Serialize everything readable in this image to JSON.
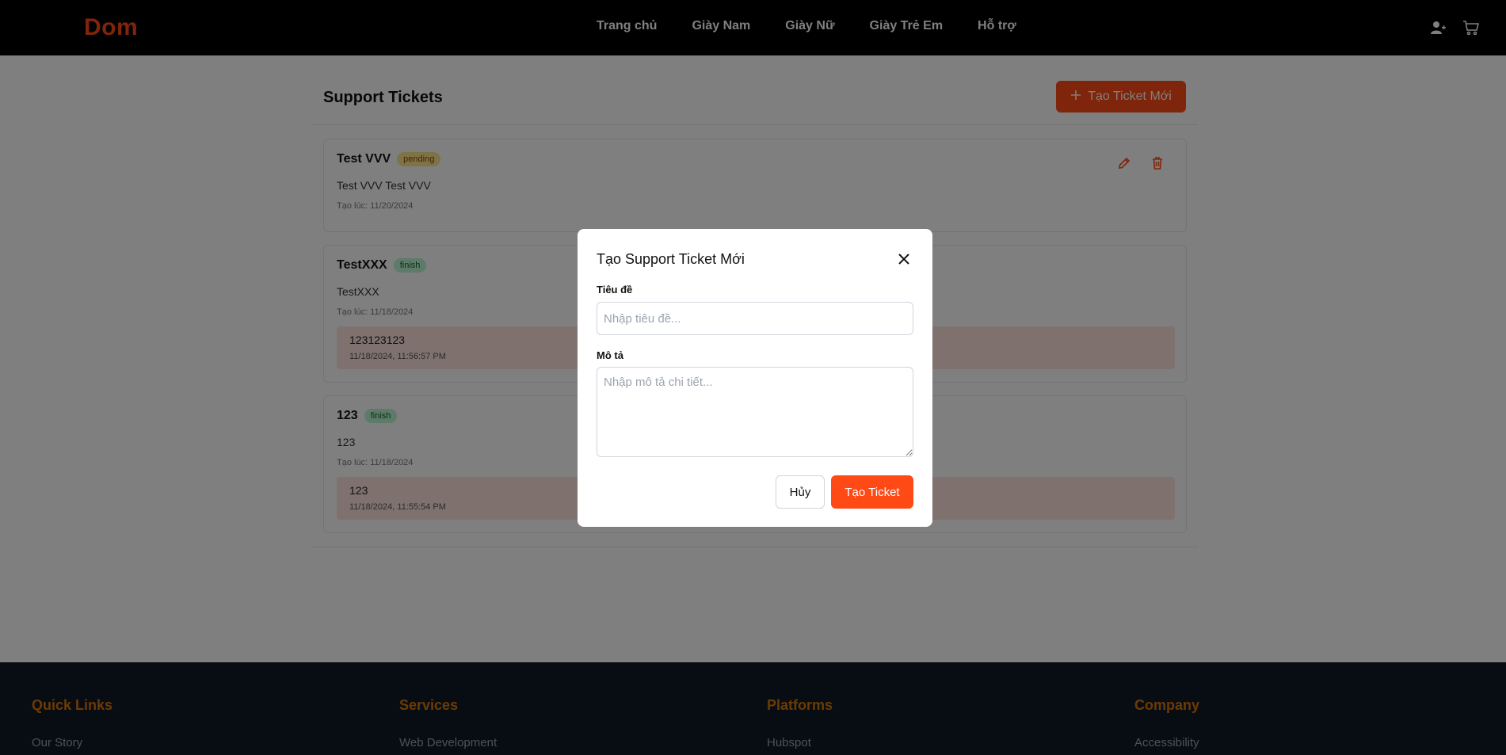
{
  "navbar": {
    "logo": "Dom",
    "links": [
      "Trang chủ",
      "Giày Nam",
      "Giày Nữ",
      "Giày Trẻ Em",
      "Hỗ trợ"
    ],
    "icons": [
      "user-plus-icon",
      "cart-icon"
    ]
  },
  "page": {
    "title": "Support Tickets",
    "new_ticket_label": "Tạo Ticket Mới"
  },
  "tickets": [
    {
      "title": "Test VVV",
      "status": "pending",
      "description": "Test VVV Test VVV",
      "created": "Tạo lúc: 11/20/2024"
    },
    {
      "title": "TestXXX",
      "status": "finish",
      "description": "TestXXX",
      "created": "Tạo lúc: 11/18/2024",
      "reply": {
        "text": "123123123",
        "time": "11/18/2024, 11:56:57 PM"
      }
    },
    {
      "title": "123",
      "status": "finish",
      "description": "123",
      "created": "Tạo lúc: 11/18/2024",
      "reply": {
        "text": "123",
        "time": "11/18/2024, 11:55:54 PM"
      }
    }
  ],
  "footer": {
    "columns": [
      {
        "heading": "Quick Links",
        "first_link": "Our Story"
      },
      {
        "heading": "Services",
        "first_link": "Web Development"
      },
      {
        "heading": "Platforms",
        "first_link": "Hubspot"
      },
      {
        "heading": "Company",
        "first_link": "Accessibility"
      }
    ]
  },
  "modal": {
    "title": "Tạo Support Ticket Mới",
    "title_label": "Tiêu đề",
    "title_placeholder": "Nhập tiêu đề...",
    "description_label": "Mô tả",
    "description_placeholder": "Nhập mô tả chi tiết...",
    "cancel_label": "Hủy",
    "submit_label": "Tạo Ticket"
  },
  "colors": {
    "accent": "#ff4a16",
    "navbar_bg": "#000000",
    "footer_bg": "#111827",
    "footer_heading": "#d97706",
    "pending_badge": "#fde68a",
    "finish_badge": "#bbf7d0",
    "reply_bg": "#ffe4dd"
  }
}
